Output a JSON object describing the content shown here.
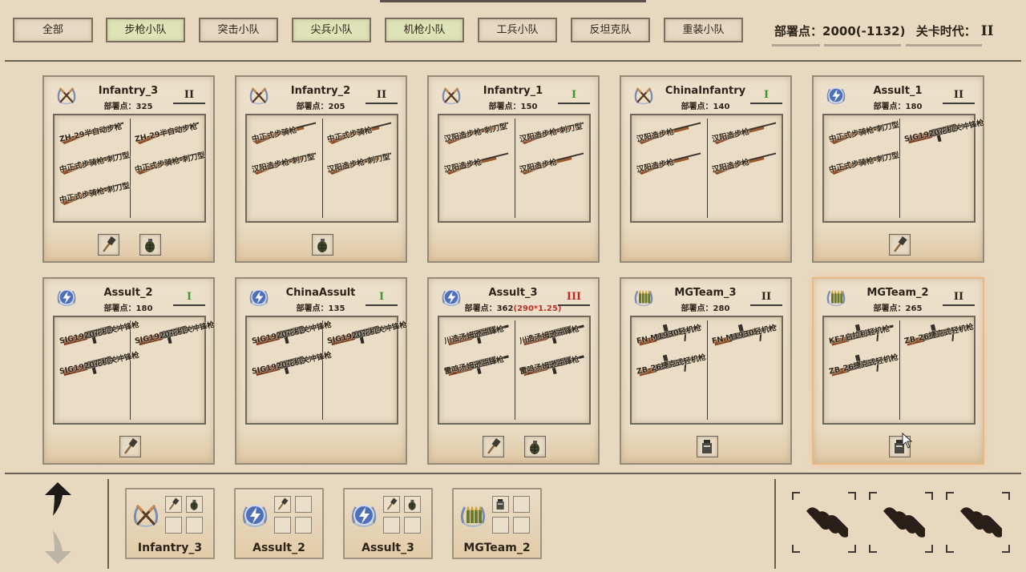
{
  "filters": [
    {
      "label": "全部",
      "active": false
    },
    {
      "label": "步枪小队",
      "active": true
    },
    {
      "label": "突击小队",
      "active": false
    },
    {
      "label": "尖兵小队",
      "active": true
    },
    {
      "label": "机枪小队",
      "active": true
    },
    {
      "label": "工兵小队",
      "active": false
    },
    {
      "label": "反坦克队",
      "active": false
    },
    {
      "label": "重装小队",
      "active": false
    }
  ],
  "header": {
    "deploy_label": "部署点：",
    "deploy_value": "2000(-1132)",
    "era_label": "关卡时代：",
    "era_value": "II"
  },
  "cards": [
    {
      "name": "Infantry_3",
      "points": "部署点：325",
      "mult": "",
      "era": "II",
      "era_color": "dark",
      "emblem": "rifles-emblem",
      "weapons": [
        [
          "ZH-29半自动步枪",
          "ZH-29半自动步枪"
        ],
        [
          "中正式步骑枪-刺刀型",
          "中正式步骑枪-刺刀型"
        ],
        [
          "中正式步骑枪-刺刀型"
        ]
      ],
      "items": [
        "stick-grenade-icon",
        "frag-grenade-icon"
      ]
    },
    {
      "name": "Infantry_2",
      "points": "部署点：205",
      "mult": "",
      "era": "II",
      "era_color": "dark",
      "emblem": "rifles-emblem",
      "weapons": [
        [
          "中正式步骑枪",
          "中正式步骑枪"
        ],
        [
          "汉阳造步枪-刺刀型",
          "汉阳造步枪-刺刀型"
        ]
      ],
      "items": [
        "frag-grenade-icon"
      ]
    },
    {
      "name": "Infantry_1",
      "points": "部署点：150",
      "mult": "",
      "era": "I",
      "era_color": "green",
      "emblem": "rifles-emblem",
      "weapons": [
        [
          "汉阳造步枪-刺刀型",
          "汉阳造步枪-刺刀型"
        ],
        [
          "汉阳造步枪",
          "汉阳造步枪"
        ]
      ],
      "items": []
    },
    {
      "name": "ChinaInfantry",
      "points": "部署点：140",
      "mult": "",
      "era": "I",
      "era_color": "green",
      "emblem": "rifles-emblem",
      "weapons": [
        [
          "汉阳造步枪",
          "汉阳造步枪"
        ],
        [
          "汉阳造步枪",
          "汉阳造步枪"
        ]
      ],
      "items": []
    },
    {
      "name": "Assult_1",
      "points": "部署点：180",
      "mult": "",
      "era": "II",
      "era_color": "dark",
      "emblem": "lightning-emblem",
      "weapons": [
        [
          "中正式步骑枪-刺刀型",
          "SIG1920花机关冲锋枪"
        ],
        [
          "中正式步骑枪-刺刀型"
        ]
      ],
      "items": [
        "stick-grenade-icon"
      ]
    },
    {
      "name": "Assult_2",
      "points": "部署点：180",
      "mult": "",
      "era": "I",
      "era_color": "green",
      "emblem": "lightning-emblem",
      "weapons": [
        [
          "SIG1920花机关冲锋枪",
          "SIG1920花机关冲锋枪"
        ],
        [
          "SIG1920花机关冲锋枪"
        ]
      ],
      "items": [
        "stick-grenade-icon"
      ]
    },
    {
      "name": "ChinaAssult",
      "points": "部署点：135",
      "mult": "",
      "era": "I",
      "era_color": "green",
      "emblem": "lightning-emblem",
      "weapons": [
        [
          "SIG1920花机关冲锋枪",
          "SIG1920花机关冲锋枪"
        ],
        [
          "SIG1920花机关冲锋枪"
        ]
      ],
      "items": []
    },
    {
      "name": "Assult_3",
      "points": "部署点：362",
      "mult": "(290*1.25)",
      "era": "III",
      "era_color": "red",
      "emblem": "lightning-emblem",
      "weapons": [
        [
          "川造汤姆逊冲锋枪",
          "川造汤姆逊冲锋枪"
        ],
        [
          "雷鸣汤姆逊冲锋枪",
          "雷鸣汤姆逊冲锋枪"
        ]
      ],
      "items": [
        "stick-grenade-icon",
        "frag-grenade-icon"
      ]
    },
    {
      "name": "MGTeam_3",
      "points": "部署点：280",
      "mult": "",
      "era": "II",
      "era_color": "dark",
      "emblem": "bullets-emblem",
      "weapons": [
        [
          "FN M1930轻机枪",
          "FN M1930轻机枪"
        ],
        [
          "ZB-26捷克式轻机枪"
        ]
      ],
      "items": [
        "ammo-box-icon"
      ]
    },
    {
      "name": "MGTeam_2",
      "points": "部署点：265",
      "mult": "",
      "era": "II",
      "era_color": "dark",
      "emblem": "bullets-emblem",
      "weapons": [
        [
          "KE7启拉利轻机枪",
          "ZB-26捷克式轻机枪"
        ],
        [
          "ZB-26捷克式轻机枪"
        ]
      ],
      "items": [
        "ammo-box-icon"
      ]
    }
  ],
  "squads": [
    {
      "name": "Infantry_3",
      "emblem": "rifles-emblem",
      "items": [
        "stick-grenade-icon",
        "frag-grenade-icon"
      ]
    },
    {
      "name": "Assult_2",
      "emblem": "lightning-emblem",
      "items": [
        "stick-grenade-icon"
      ]
    },
    {
      "name": "Assult_3",
      "emblem": "lightning-emblem",
      "items": [
        "stick-grenade-icon",
        "frag-grenade-icon"
      ]
    },
    {
      "name": "MGTeam_2",
      "emblem": "bullets-emblem",
      "items": [
        "ammo-box-icon"
      ]
    }
  ],
  "ammo_slots": 3,
  "colors": {
    "bg": "#e8d8bf",
    "era_green": "#3d9a2c",
    "era_red": "#c02a20",
    "active_filter": "#dfe3b8"
  }
}
